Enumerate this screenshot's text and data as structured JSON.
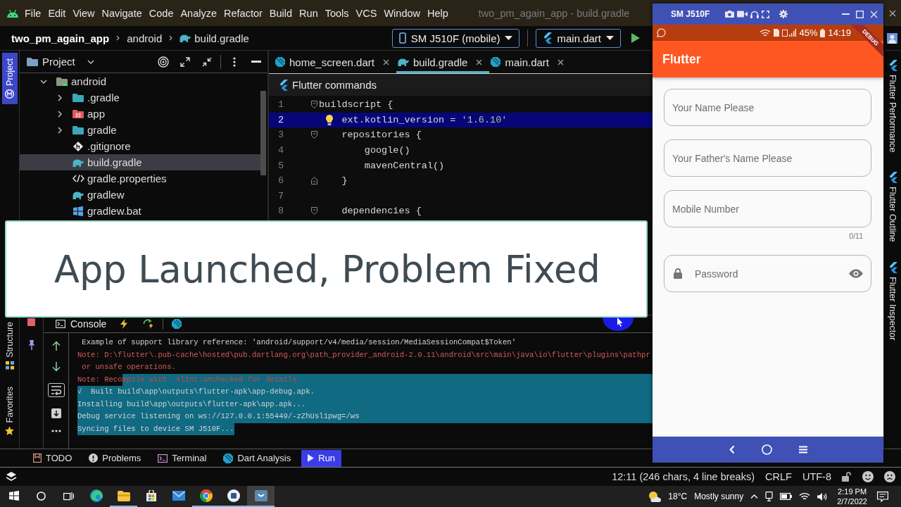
{
  "menu_bar": {
    "items": [
      "File",
      "Edit",
      "View",
      "Navigate",
      "Code",
      "Analyze",
      "Refactor",
      "Build",
      "Run",
      "Tools",
      "VCS",
      "Window",
      "Help"
    ],
    "window_title": "two_pm_again_app - build.gradle"
  },
  "nav_bar": {
    "breadcrumbs": [
      "two_pm_again_app",
      "android",
      "build.gradle"
    ],
    "device_selector": "SM J510F (mobile)",
    "run_configuration": "main.dart"
  },
  "left_stripe": [
    {
      "label": "Project",
      "kind": "project",
      "selected": true
    },
    {
      "label": "Structure",
      "kind": "structure",
      "selected": false
    },
    {
      "label": "Favorites",
      "kind": "favorites",
      "selected": false
    }
  ],
  "project_panel": {
    "title": "Project",
    "tree": [
      {
        "label": "android",
        "kind": "android",
        "expanded": true,
        "selected": false,
        "children": [
          {
            "label": ".gradle",
            "kind": "gradledir",
            "expanded": false,
            "selected": false
          },
          {
            "label": "app",
            "kind": "module",
            "expanded": false,
            "selected": false
          },
          {
            "label": "gradle",
            "kind": "gradledir",
            "expanded": false,
            "selected": false
          },
          {
            "label": ".gitignore",
            "kind": "git",
            "selected": false
          },
          {
            "label": "build.gradle",
            "kind": "gradle",
            "selected": true
          },
          {
            "label": "gradle.properties",
            "kind": "properties",
            "selected": false
          },
          {
            "label": "gradlew",
            "kind": "gradle",
            "selected": false
          },
          {
            "label": "gradlew.bat",
            "kind": "windows",
            "selected": false
          }
        ]
      }
    ]
  },
  "editor": {
    "tabs": [
      {
        "label": "home_screen.dart",
        "kind": "dart",
        "selected": false
      },
      {
        "label": "build.gradle",
        "kind": "gradle",
        "selected": true
      },
      {
        "label": "main.dart",
        "kind": "dart",
        "selected": false
      }
    ],
    "toolbar": "Flutter commands",
    "lines": [
      {
        "number": "1",
        "kind": "open",
        "highlighted": false,
        "segments": [
          {
            "kind": "plain",
            "text": "buildscript {"
          }
        ],
        "children": [
          {
            "number": "2",
            "kind": "plain",
            "highlighted": true,
            "segments": [
              {
                "kind": "plain",
                "text": "ext.kotlin_version = "
              },
              {
                "kind": "string",
                "text": "'1.6.10'"
              }
            ]
          },
          {
            "number": "3",
            "kind": "open",
            "highlighted": false,
            "segments": [
              {
                "kind": "plain",
                "text": "repositories {"
              }
            ],
            "children": [
              {
                "number": "4",
                "kind": "plain",
                "highlighted": false,
                "segments": [
                  {
                    "kind": "plain",
                    "text": "google()"
                  }
                ]
              },
              {
                "number": "5",
                "kind": "plain",
                "highlighted": false,
                "segments": [
                  {
                    "kind": "plain",
                    "text": "mavenCentral()"
                  }
                ]
              }
            ]
          },
          {
            "number": "6",
            "kind": "close",
            "highlighted": false,
            "segments": [
              {
                "kind": "plain",
                "text": "}"
              }
            ]
          },
          {
            "number": "7",
            "kind": "plain",
            "highlighted": false
          },
          {
            "number": "8",
            "kind": "open",
            "highlighted": false,
            "segments": [
              {
                "kind": "plain",
                "text": "dependencies {"
              }
            ]
          }
        ]
      }
    ]
  },
  "caption": "App Launched, Problem Fixed",
  "run_panel": {
    "tab": "Console",
    "soft_wrap": true,
    "lines": [
      {
        "kind": "info",
        "segments": [
          {
            "text": " Example of support library reference: 'android/support/v4/media/session/MediaSessionCompat$Token'",
            "selected": false
          }
        ]
      },
      {
        "kind": "error",
        "segments": [
          {
            "text": "Note: D:\\flutter\\.pub-cache\\hosted\\pub.dartlang.org\\path_provider_android-2.0.11\\android\\src\\main\\java\\io\\flutter\\plugins\\pathpr",
            "selected": false
          }
        ]
      },
      {
        "kind": "error",
        "segments": [
          {
            "text": " or unsafe operations.",
            "selected": false
          }
        ]
      },
      {
        "kind": "error",
        "segments": [
          {
            "text": "Note: Reco",
            "selected": false
          },
          {
            "text": "mpile with -Xlint:unchecked for details.",
            "selected": true
          }
        ]
      },
      {
        "kind": "info",
        "segments": [
          {
            "text": "√  Built build\\app\\outputs\\flutter-apk\\app-debug.apk.",
            "selected": true
          }
        ]
      },
      {
        "kind": "info",
        "segments": [
          {
            "text": "Installing build\\app\\outputs\\flutter-apk\\app.apk...",
            "selected": true
          }
        ]
      },
      {
        "kind": "info",
        "segments": [
          {
            "text": "Debug service listening on ws://127.0.0.1:55449/-zZhUsl1pwg=/ws",
            "selected": true
          }
        ]
      },
      {
        "kind": "info",
        "segments": [
          {
            "text": "Syncing files to device SM J510F...",
            "selected": true
          }
        ]
      }
    ]
  },
  "bottom_tabs": [
    {
      "label": "TODO",
      "kind": "todo",
      "selected": false
    },
    {
      "label": "Problems",
      "kind": "problems",
      "selected": false
    },
    {
      "label": "Terminal",
      "kind": "terminal",
      "selected": false
    },
    {
      "label": "Dart Analysis",
      "kind": "dart",
      "selected": false
    },
    {
      "label": "Run",
      "kind": "run",
      "selected": true
    }
  ],
  "status_bar": {
    "caret": "12:11 (246 chars, 4 line breaks)",
    "line_separator": "CRLF",
    "encoding": "UTF-8"
  },
  "right_stripe": [
    {
      "label": "Flutter Performance",
      "selected": false
    },
    {
      "label": "Flutter Outline",
      "selected": false
    },
    {
      "label": "Flutter Inspector",
      "selected": false
    }
  ],
  "emulator": {
    "title": "SM J510F",
    "battery": "45%",
    "time": "14:19",
    "debug_banner": "DEBUG",
    "app_bar_title": "Flutter",
    "fields": [
      {
        "kind": "text",
        "placeholder": "Your Name Please"
      },
      {
        "kind": "text",
        "placeholder": "Your Father's Name Please"
      },
      {
        "kind": "text",
        "placeholder": "Mobile Number",
        "counter": "0/11"
      },
      {
        "kind": "password",
        "placeholder": "Password"
      }
    ]
  },
  "taskbar": {
    "apps": [
      {
        "kind": "edge",
        "running": false,
        "selected": false
      },
      {
        "kind": "explorer",
        "running": true,
        "selected": false
      },
      {
        "kind": "store",
        "running": false,
        "selected": false
      },
      {
        "kind": "mail",
        "running": false,
        "selected": false
      },
      {
        "kind": "chrome",
        "running": true,
        "selected": false
      },
      {
        "kind": "word",
        "running": true,
        "selected": false
      },
      {
        "kind": "studio",
        "running": true,
        "selected": true
      }
    ],
    "temperature": "18°C",
    "weather": "Mostly sunny",
    "time": "2:19 PM",
    "date": "2/7/2022"
  }
}
